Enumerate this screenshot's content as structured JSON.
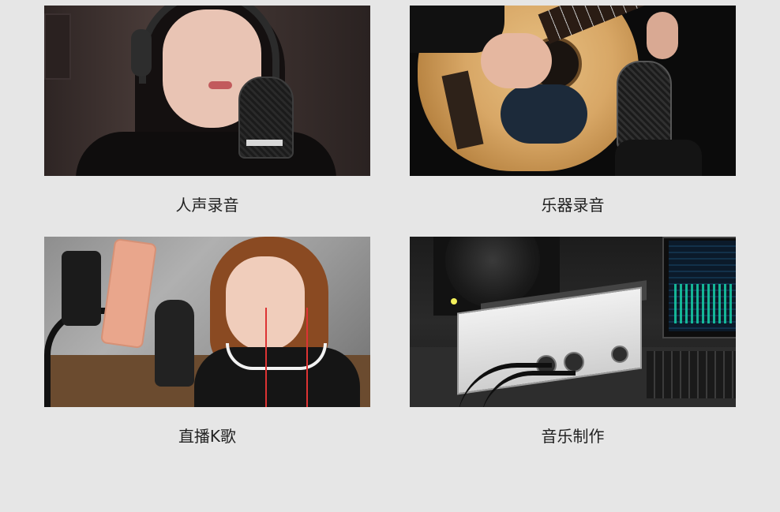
{
  "tiles": [
    {
      "caption": "人声录音"
    },
    {
      "caption": "乐器录音"
    },
    {
      "caption": "直播K歌"
    },
    {
      "caption": "音乐制作"
    }
  ]
}
